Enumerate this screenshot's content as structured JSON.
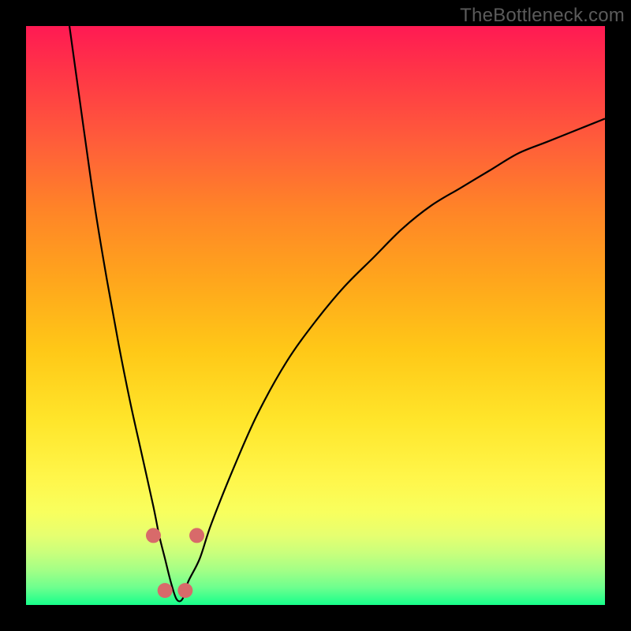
{
  "watermark": "TheBottleneck.com",
  "chart_data": {
    "type": "line",
    "title": "",
    "xlabel": "",
    "ylabel": "",
    "xlim": [
      0,
      100
    ],
    "ylim": [
      0,
      100
    ],
    "grid": false,
    "legend": false,
    "background_gradient": {
      "direction": "vertical",
      "stops": [
        {
          "pos": 0.0,
          "color": "#ff1a53"
        },
        {
          "pos": 0.2,
          "color": "#ff5d3a"
        },
        {
          "pos": 0.44,
          "color": "#ffa61c"
        },
        {
          "pos": 0.68,
          "color": "#ffe52a"
        },
        {
          "pos": 0.88,
          "color": "#e6ff70"
        },
        {
          "pos": 1.0,
          "color": "#17ff8b"
        }
      ]
    },
    "series": [
      {
        "name": "bottleneck-curve",
        "color": "#000000",
        "x": [
          7.5,
          10,
          12,
          14,
          16,
          18,
          20,
          22,
          23,
          24,
          25,
          26,
          27,
          28,
          30,
          32,
          36,
          40,
          45,
          50,
          55,
          60,
          65,
          70,
          75,
          80,
          85,
          90,
          95,
          100
        ],
        "values": [
          100,
          82,
          68,
          56,
          45,
          35,
          26,
          17,
          12,
          8,
          4,
          1,
          1,
          4,
          8,
          14,
          24,
          33,
          42,
          49,
          55,
          60,
          65,
          69,
          72,
          75,
          78,
          80,
          82,
          84
        ]
      }
    ],
    "markers": {
      "name": "highlighted-points",
      "color": "#d86a6a",
      "shape": "rounded-square",
      "points": [
        {
          "x": 22.0,
          "y": 12.0
        },
        {
          "x": 24.0,
          "y": 2.5
        },
        {
          "x": 27.5,
          "y": 2.5
        },
        {
          "x": 29.5,
          "y": 12.0
        }
      ]
    }
  }
}
